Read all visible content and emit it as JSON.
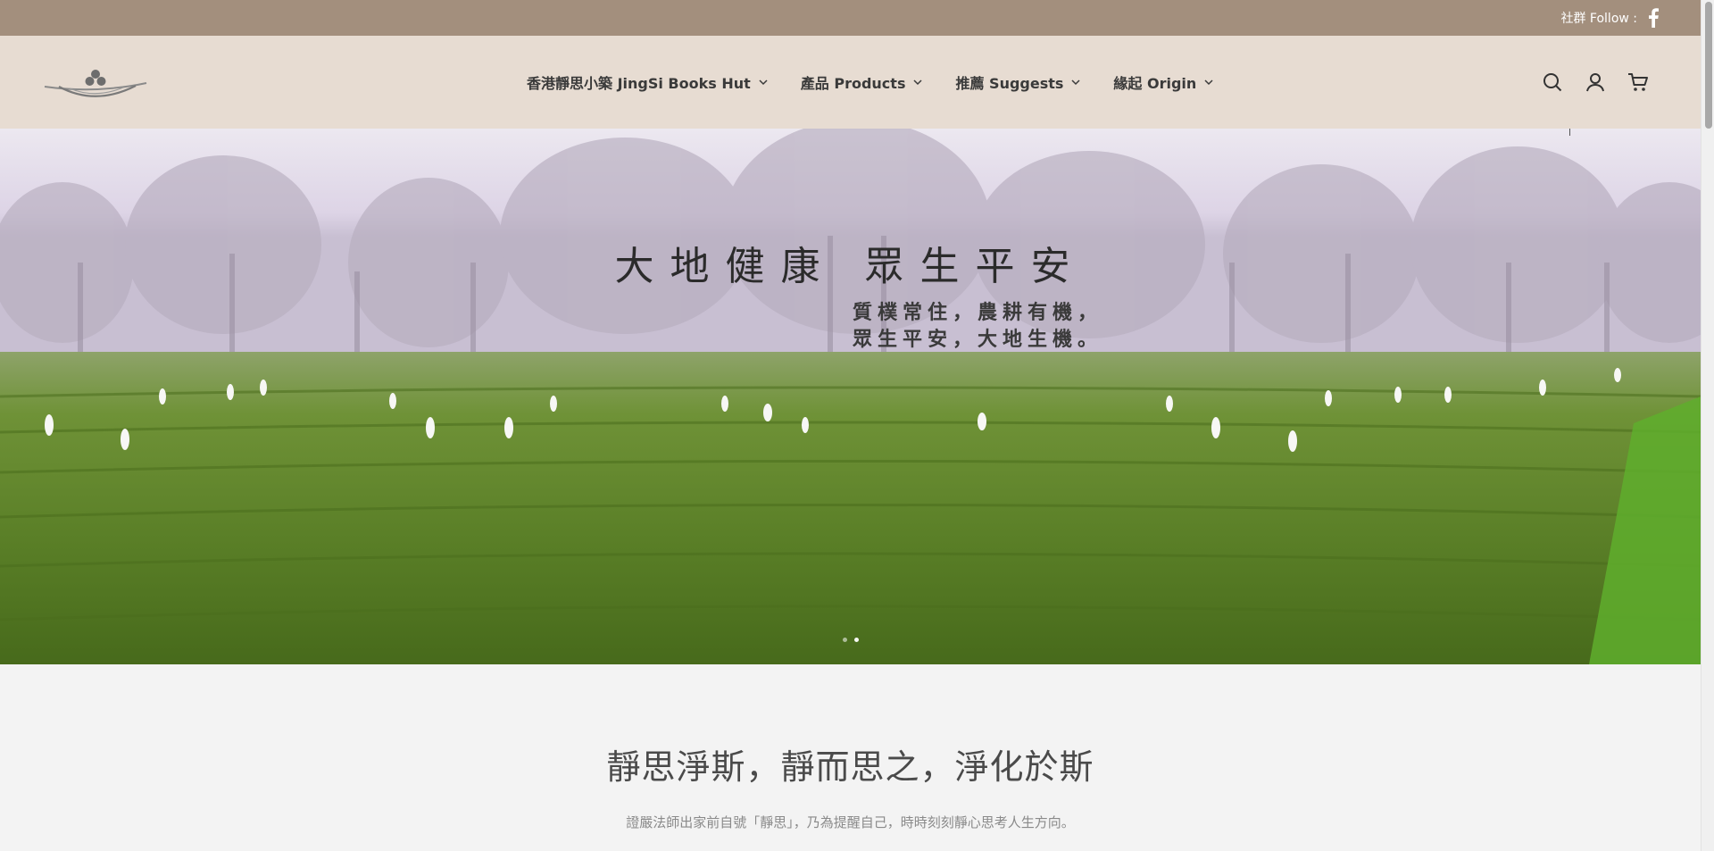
{
  "topbar": {
    "social_label": "社群 Follow :",
    "social_icon": "facebook-icon",
    "bg_color": "#a38f7d"
  },
  "header": {
    "logo_icon": "jingsi-logo",
    "bg_color": "#e7dcd2",
    "nav": [
      {
        "label": "香港靜思小築 JingSi Books Hut"
      },
      {
        "label": "產品 Products"
      },
      {
        "label": "推薦 Suggests"
      },
      {
        "label": "緣起 Origin"
      }
    ],
    "icons": [
      "search-icon",
      "account-icon",
      "cart-icon"
    ]
  },
  "hero": {
    "title": "大地健康 眾生平安",
    "subtitle_line1": "質樸常住，農耕有機，",
    "subtitle_line2": "眾生平安，大地生機。",
    "slides_count": 2,
    "active_slide": 2
  },
  "intro": {
    "title": "靜思淨斯，靜而思之，淨化於斯",
    "text": "證嚴法師出家前自號「靜思」，乃為提醒自己，時時刻刻靜心思考人生方向。"
  }
}
